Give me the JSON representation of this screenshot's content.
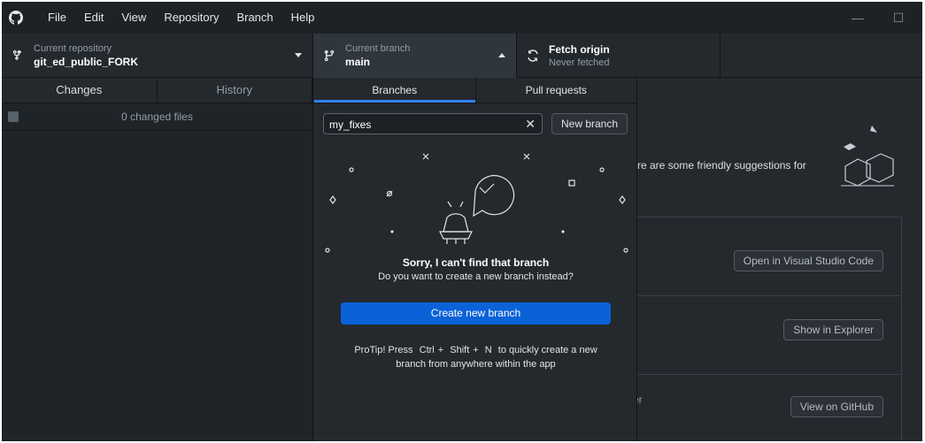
{
  "menu": [
    "File",
    "Edit",
    "View",
    "Repository",
    "Branch",
    "Help"
  ],
  "window_controls": {
    "minimize": "—",
    "maximize": "☐"
  },
  "toolbar": {
    "repo_label": "Current repository",
    "repo_value": "git_ed_public_FORK",
    "branch_label": "Current branch",
    "branch_value": "main",
    "fetch_title": "Fetch origin",
    "fetch_sub": "Never fetched"
  },
  "sidebar": {
    "tabs": [
      "Changes",
      "History"
    ],
    "changed_files": "0 changed files"
  },
  "popover": {
    "tabs": [
      "Branches",
      "Pull requests"
    ],
    "filter_value": "my_fixes",
    "new_branch": "New branch",
    "sorry_title": "Sorry, I can't find that branch",
    "sorry_sub": "Do you want to create a new branch instead?",
    "create_button": "Create new branch",
    "protip_prefix": "ProTip! Press",
    "protip_key1": "Ctrl",
    "protip_plus1": "+",
    "protip_key2": "Shift",
    "protip_plus2": "+",
    "protip_key3": "N",
    "protip_mid": "to quickly create a new",
    "protip_line2": "branch from anywhere within the app"
  },
  "main": {
    "suggestion_text": "re are some friendly suggestions for",
    "open_vscode": "Open in Visual Studio Code",
    "show_explorer": "Show in Explorer",
    "view_github": "View on GitHub",
    "stub_text": "er"
  },
  "colors": {
    "accent": "#0a62d8",
    "tab_underline": "#2f81f7",
    "background": "#24292e"
  }
}
